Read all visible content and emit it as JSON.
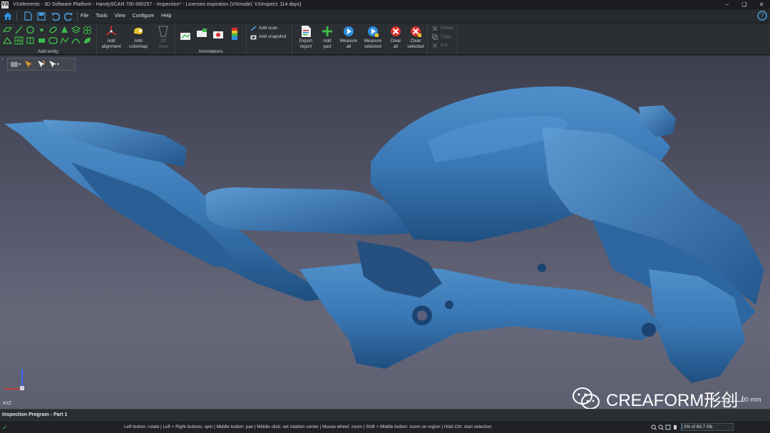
{
  "window": {
    "title": "VXelements - 3D Software Platform - HandySCAN 700 660257 - Inspection* - Licenses expiration (VXmodel, VXinspect: 114 days)",
    "logo_text": "VX"
  },
  "menu": {
    "items": [
      "File",
      "Tools",
      "View",
      "Configure",
      "Help"
    ]
  },
  "ribbon": {
    "add_entity_label": "Add entity",
    "add_alignment": "Add alignment",
    "add_colormap": "Add colormap",
    "view_2d": "2D view",
    "annotations_label": "Annotations",
    "add_scan": "Add scan",
    "add_snapshot": "Add snapshot",
    "export_report": "Export report",
    "add_part": "Add part",
    "measure_all": "Measure all",
    "measure_selected": "Measure selected",
    "clear_all": "Clear all",
    "clear_selected": "Clear selected",
    "delete": "Delete",
    "copy": "Copy",
    "cut": "Cut"
  },
  "viewport": {
    "scale_label": "00 mm",
    "axis_label": "XYZ",
    "watermark_text": "CREAFORM形创",
    "model_color": "#3a78b5"
  },
  "panel": {
    "title": "Inspection Program - Part 1"
  },
  "status": {
    "hints": "Left button: rotate  |  Left + Right buttons: spin  |  Middle button: pan  |  Middle click: set rotation center  |  Mouse wheel: zoom  |  Shift + Middle button: zoom on region  |  Hold Ctrl: start selection",
    "memory_text": "2% of 60,7 Gb",
    "memory_fraction": 0.02
  },
  "colors": {
    "accent_blue": "#2f8fdc",
    "add_green": "#3dbb4b",
    "clear_red": "#d9312d"
  }
}
